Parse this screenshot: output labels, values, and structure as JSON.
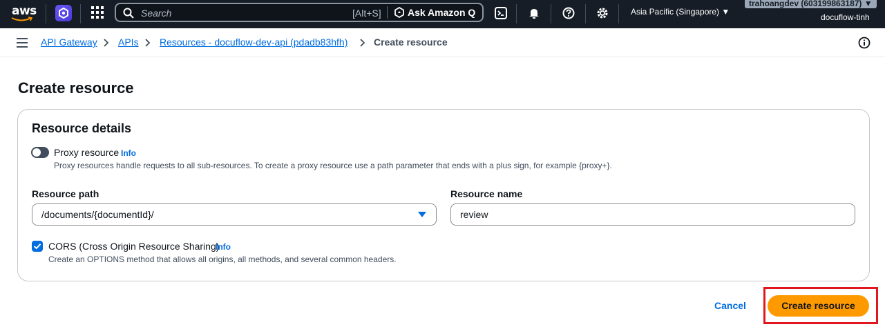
{
  "topnav": {
    "logo_text": "aws",
    "search_placeholder": "Search",
    "search_shortcut": "[Alt+S]",
    "ask_q_label": "Ask Amazon Q",
    "region": "Asia Pacific (Singapore) ▼",
    "account_badge": "trahoangdev (603199863187) ▼",
    "account_user": "docuflow-tinh",
    "colors": {
      "bg": "#161d26",
      "service_icon": "#5b47ef"
    }
  },
  "breadcrumb": {
    "items": [
      {
        "label": "API Gateway"
      },
      {
        "label": "APIs"
      },
      {
        "label": "Resources - docuflow-dev-api (pdadb83hfh)"
      },
      {
        "label": "Create resource"
      }
    ]
  },
  "page": {
    "title": "Create resource",
    "panel_title": "Resource details",
    "proxy": {
      "label": "Proxy resource",
      "info": "Info",
      "enabled": false,
      "description": "Proxy resources handle requests to all sub-resources. To create a proxy resource use a path parameter that ends with a plus sign, for example {proxy+}."
    },
    "resource_path": {
      "label": "Resource path",
      "value": "/documents/{documentId}/"
    },
    "resource_name": {
      "label": "Resource name",
      "value": "review"
    },
    "cors": {
      "label": "CORS (Cross Origin Resource Sharing)",
      "info": "Info",
      "checked": true,
      "description": "Create an OPTIONS method that allows all origins, all methods, and several common headers."
    },
    "actions": {
      "cancel": "Cancel",
      "submit": "Create resource"
    },
    "colors": {
      "link": "#006ce0",
      "primary": "#ff9900",
      "highlight": "#e0181e"
    }
  }
}
